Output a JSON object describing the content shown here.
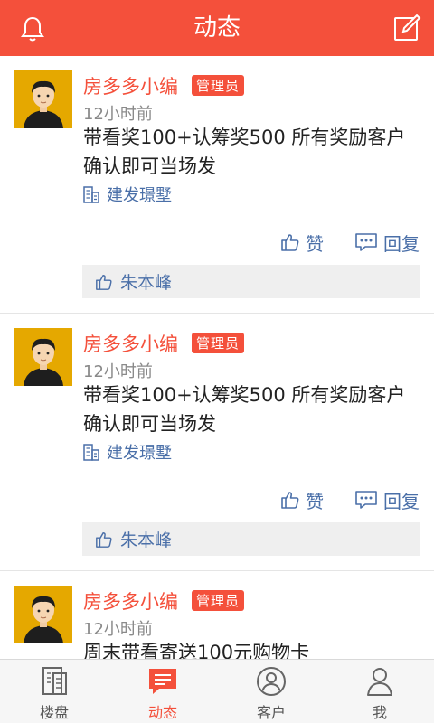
{
  "header": {
    "title": "动态"
  },
  "posts": [
    {
      "author": "房多多小编",
      "badge": "管理员",
      "time": "12小时前",
      "content": "带看奖100+认筹奖500 所有奖励客户确认即可当场发",
      "building": "建发璟墅",
      "like_label": "赞",
      "reply_label": "回复",
      "liked_by": "朱本峰"
    },
    {
      "author": "房多多小编",
      "badge": "管理员",
      "time": "12小时前",
      "content": "带看奖100+认筹奖500 所有奖励客户确认即可当场发",
      "building": "建发璟墅",
      "like_label": "赞",
      "reply_label": "回复",
      "liked_by": "朱本峰"
    },
    {
      "author": "房多多小编",
      "badge": "管理员",
      "time": "12小时前",
      "content": "周末带看寄送100元购物卡"
    }
  ],
  "tabs": [
    {
      "label": "楼盘",
      "icon": "document-icon",
      "active": false
    },
    {
      "label": "动态",
      "icon": "message-icon",
      "active": true
    },
    {
      "label": "客户",
      "icon": "customer-icon",
      "active": false
    },
    {
      "label": "我",
      "icon": "person-icon",
      "active": false
    }
  ],
  "colors": {
    "brand": "#f4503b",
    "link": "#4a6fa8"
  }
}
